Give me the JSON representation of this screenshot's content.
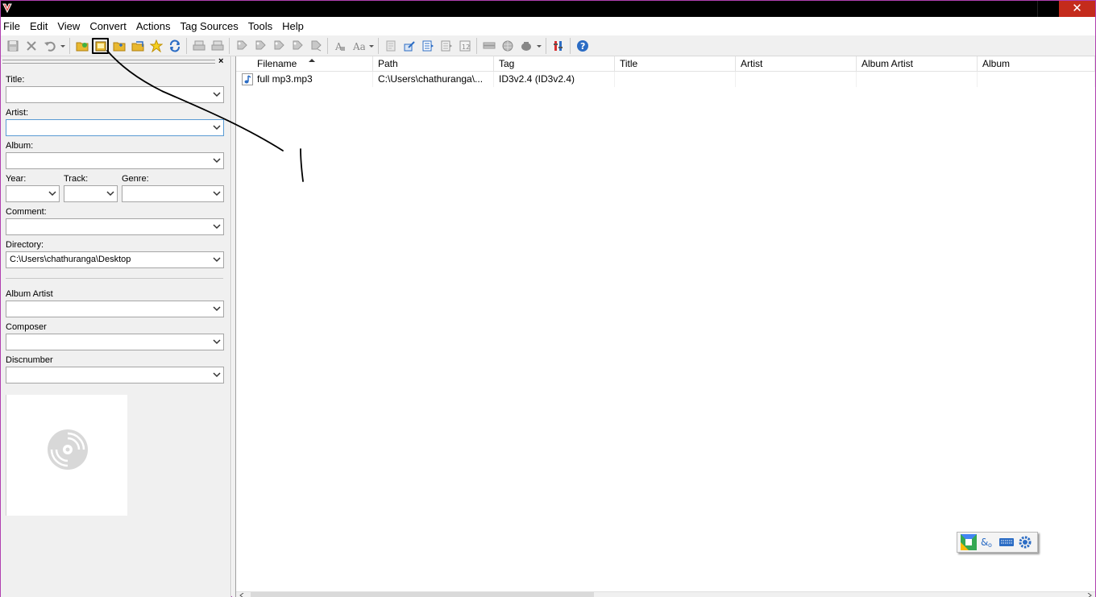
{
  "window": {
    "close_glyph": "✕"
  },
  "menu": [
    "File",
    "Edit",
    "View",
    "Convert",
    "Actions",
    "Tag Sources",
    "Tools",
    "Help"
  ],
  "toolbar": {
    "icons": [
      "save-icon",
      "remove-tag-icon",
      "undo-icon",
      "open-directory-icon",
      "change-directory-icon",
      "add-directory-icon",
      "playlist-icon",
      "favorites-icon",
      "refresh-icon",
      "export-icon",
      "tag-tag-icon",
      "case-conversion-icon",
      "options-icon",
      "help-icon"
    ]
  },
  "left_panel": {
    "close_glyph": "×",
    "fields": {
      "title": {
        "label": "Title:",
        "value": ""
      },
      "artist": {
        "label": "Artist:",
        "value": ""
      },
      "album": {
        "label": "Album:",
        "value": ""
      },
      "year": {
        "label": "Year:",
        "value": ""
      },
      "track": {
        "label": "Track:",
        "value": ""
      },
      "genre": {
        "label": "Genre:",
        "value": ""
      },
      "comment": {
        "label": "Comment:",
        "value": ""
      },
      "directory": {
        "label": "Directory:",
        "value": "C:\\Users\\chathuranga\\Desktop"
      },
      "album_artist": {
        "label": "Album Artist",
        "value": ""
      },
      "composer": {
        "label": "Composer",
        "value": ""
      },
      "discnumber": {
        "label": "Discnumber",
        "value": ""
      }
    }
  },
  "file_list": {
    "columns": [
      "Filename",
      "Path",
      "Tag",
      "Title",
      "Artist",
      "Album Artist",
      "Album"
    ],
    "sort_column": "Filename",
    "rows": [
      {
        "filename": "full mp3.mp3",
        "path": "C:\\Users\\chathuranga\\...",
        "tag": "ID3v2.4 (ID3v2.4)",
        "title": "",
        "artist": "",
        "album_artist": "",
        "album": ""
      }
    ]
  },
  "colors": {
    "accent": "#2b6cc4",
    "folder": "#e8b830",
    "close": "#c42b1c"
  }
}
